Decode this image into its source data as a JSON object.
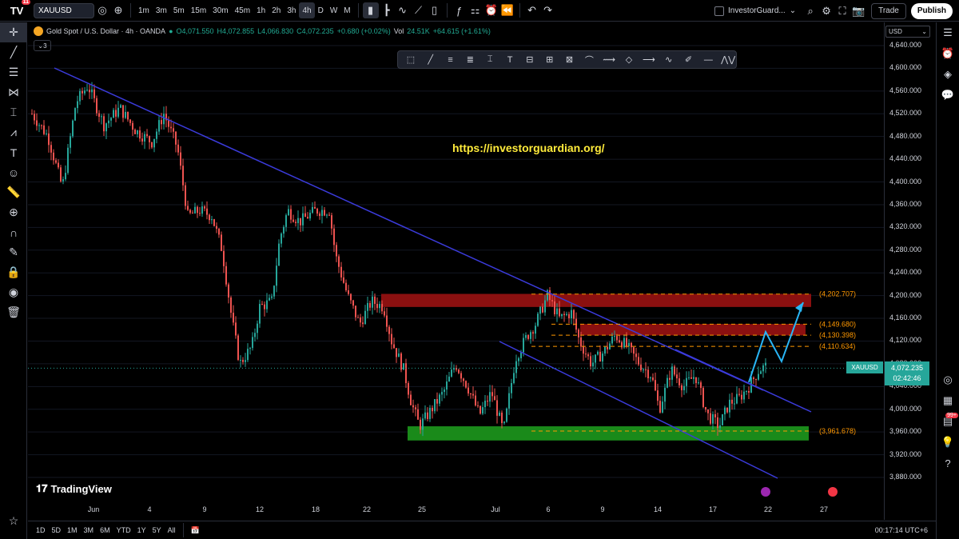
{
  "topbar": {
    "logo_badge": "11",
    "symbol": "XAUUSD",
    "intervals": [
      "1m",
      "3m",
      "5m",
      "15m",
      "30m",
      "45m",
      "1h",
      "2h",
      "3h",
      "4h",
      "D",
      "W",
      "M"
    ],
    "active_interval": "4h",
    "layout_name": "InvestorGuard...",
    "trade_label": "Trade",
    "publish_label": "Publish"
  },
  "legend": {
    "title": "Gold Spot / U.S. Dollar · 4h · OANDA",
    "open": "O4,071.550",
    "high": "H4,072.855",
    "low": "L4,066.830",
    "close": "C4,072.235",
    "change": "+0.680 (+0.02%)",
    "volume_label": "Vol",
    "volume": "24.51K",
    "volume_change": "+64.615 (+1.61%)",
    "indicators_count": "3"
  },
  "watermark": "https://investorguardian.org/",
  "brand": "TradingView",
  "currency": "USD",
  "price_axis": {
    "labels": [
      "4,640.000",
      "4,600.000",
      "4,560.000",
      "4,520.000",
      "4,480.000",
      "4,440.000",
      "4,400.000",
      "4,360.000",
      "4,320.000",
      "4,280.000",
      "4,240.000",
      "4,200.000",
      "4,160.000",
      "4,120.000",
      "4,080.000",
      "4,040.000",
      "4,000.000",
      "3,960.000",
      "3,920.000",
      "3,880.000"
    ],
    "current_price": "4,072.235",
    "countdown": "02:42:46",
    "symbol_tag": "XAUUSD"
  },
  "time_axis": [
    "Jun",
    "4",
    "9",
    "12",
    "18",
    "22",
    "25",
    "Jul",
    "6",
    "9",
    "14",
    "17",
    "22",
    "27"
  ],
  "levels": [
    {
      "label": "(4,202.707)",
      "value": 4202.707
    },
    {
      "label": "(4,149.680)",
      "value": 4149.68
    },
    {
      "label": "(4,130.398)",
      "value": 4130.398
    },
    {
      "label": "(4,110.634)",
      "value": 4110.634
    },
    {
      "label": "(3,961.678)",
      "value": 3961.678
    }
  ],
  "bottombar": {
    "ranges": [
      "1D",
      "5D",
      "1M",
      "3M",
      "6M",
      "YTD",
      "1Y",
      "5Y",
      "All"
    ],
    "clock": "00:17:14 UTC+6"
  },
  "colors": {
    "up": "#26a69a",
    "down": "#ef5350",
    "trend": "#3b3bdb",
    "level": "#ff9800",
    "resistance": "#8b1010",
    "support": "#1a8a1a",
    "projection": "#29b6f6"
  },
  "left_tools": [
    "crosshair-icon",
    "trendline-icon",
    "fib-icon",
    "pattern-icon",
    "projection-icon",
    "brush-icon",
    "text-icon",
    "emoji-icon",
    "ruler-icon",
    "zoom-icon",
    "magnet-icon",
    "lock-drawings-icon",
    "lock-icon",
    "eye-icon",
    "trash-icon"
  ],
  "right_tools": [
    "watchlist-icon",
    "alerts-icon",
    "layers-icon",
    "chat-icon",
    "target-icon",
    "calendar-icon",
    "news-icon",
    "ideas-icon",
    "help-icon"
  ],
  "notification_badge": "99+"
}
